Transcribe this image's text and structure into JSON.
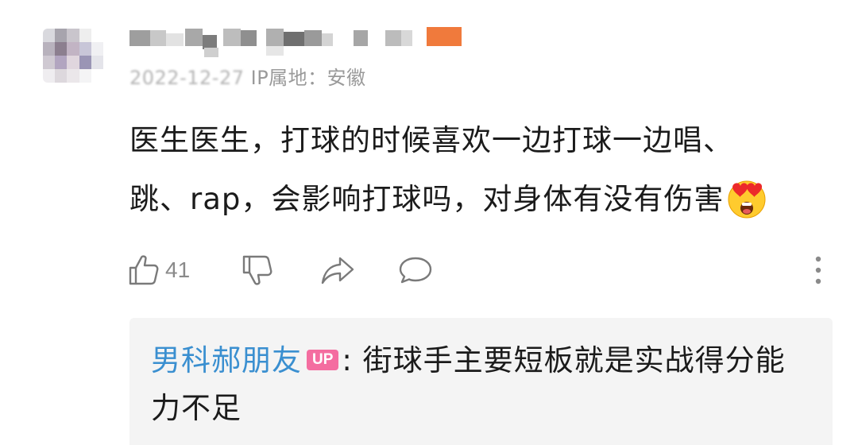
{
  "comment": {
    "date": "2022-12-27",
    "ip_location": "IP属地：安徽",
    "line1": "医生医生，打球的时候喜欢一边打球一边唱、",
    "line2": "跳、rap，会影响打球吗，对身体有没有伤害",
    "emoji": "heart-eyes-emoji"
  },
  "actions": {
    "like_count": "41",
    "like_icon": "thumbs-up-icon",
    "dislike_icon": "thumbs-down-icon",
    "share_icon": "share-icon",
    "reply_icon": "comment-bubble-icon",
    "more_icon": "more-vertical-icon"
  },
  "reply": {
    "author": "男科郝朋友",
    "badge": "UP",
    "separator": ":",
    "text_line1": " 街球手主要短板就是实战得分能",
    "text_line2": "力不足"
  },
  "colors": {
    "author": "#3a8fd0",
    "badge": "#f46da0",
    "meta": "#9a9a9a",
    "reply_bg": "#f4f4f4"
  }
}
